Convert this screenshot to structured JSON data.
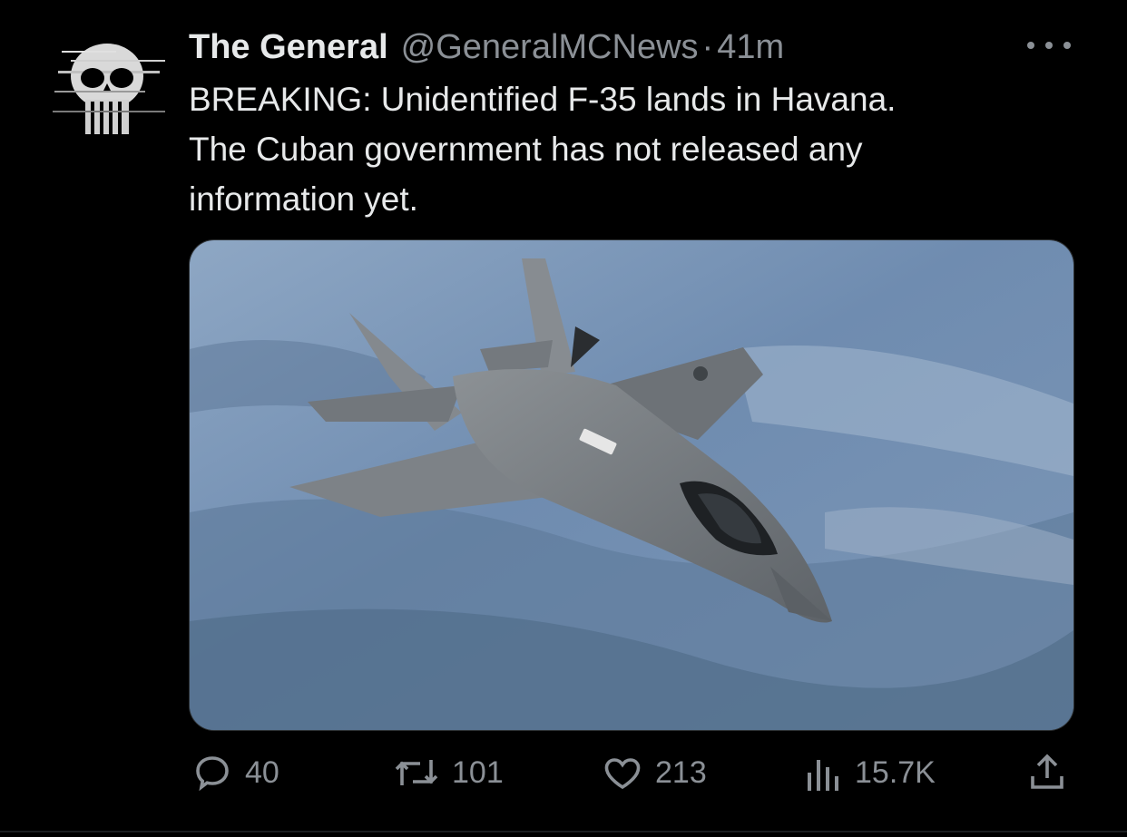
{
  "tweet": {
    "author_name": "The General",
    "handle": "@GeneralMCNews",
    "separator": "·",
    "time": "41m",
    "text": "BREAKING: Unidentified F-35 lands in Havana.\nThe Cuban government has not released any\ninformation yet.",
    "avatar_icon": "skull-avatar-icon",
    "media_description_icon": "f35-jet-photo",
    "more_icon": "more-options-icon"
  },
  "actions": {
    "reply_count": "40",
    "retweet_count": "101",
    "like_count": "213",
    "views_count": "15.7K",
    "reply_icon": "reply-icon",
    "retweet_icon": "retweet-icon",
    "like_icon": "heart-icon",
    "views_icon": "views-icon",
    "share_icon": "share-icon"
  },
  "colors": {
    "background": "#000000",
    "text": "#e7e9ea",
    "muted": "#8b9096"
  }
}
